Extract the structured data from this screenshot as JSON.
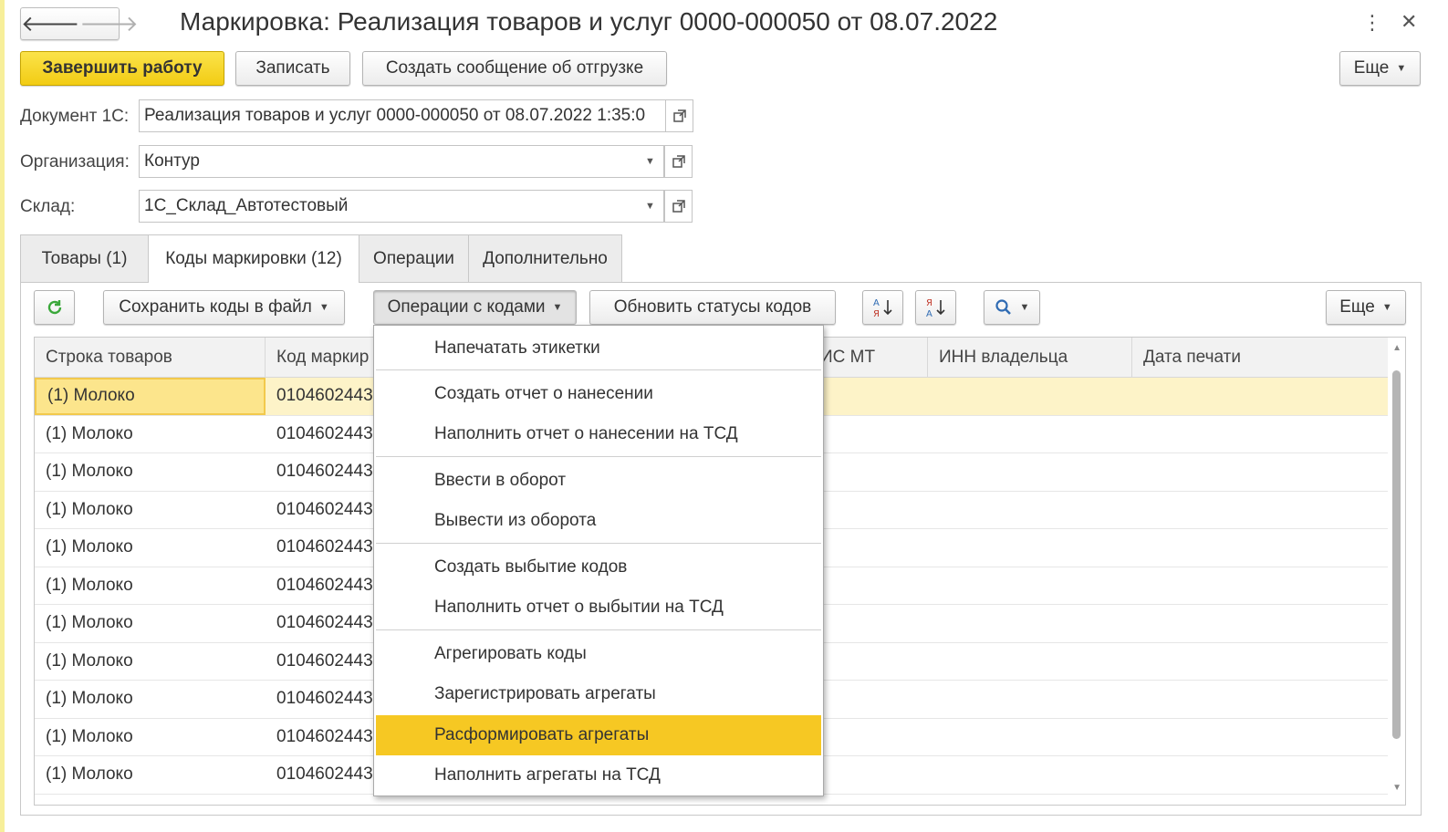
{
  "window": {
    "title": "Маркировка: Реализация товаров и услуг 0000-000050 от 08.07.2022"
  },
  "toolbar": {
    "finish_label": "Завершить работу",
    "save_label": "Записать",
    "create_msg_label": "Создать сообщение об отгрузке",
    "more_label": "Еще"
  },
  "form": {
    "doc_label": "Документ 1С:",
    "doc_value": "Реализация товаров и услуг 0000-000050 от 08.07.2022 1:35:0",
    "org_label": "Организация:",
    "org_value": "Контур",
    "warehouse_label": "Склад:",
    "warehouse_value": "1С_Склад_Автотестовый"
  },
  "tabs": [
    {
      "label": "Товары (1)",
      "active": false
    },
    {
      "label": "Коды маркировки (12)",
      "active": true
    },
    {
      "label": "Операции",
      "active": false
    },
    {
      "label": "Дополнительно",
      "active": false
    }
  ],
  "codes_toolbar": {
    "save_codes_label": "Сохранить коды в файл",
    "ops_label": "Операции с кодами",
    "refresh_statuses_label": "Обновить статусы кодов",
    "more_label": "Еще"
  },
  "grid": {
    "columns": [
      "Строка товаров",
      "Код маркир",
      "ИС МТ",
      "ИНН владельца",
      "Дата печати"
    ],
    "rows": [
      {
        "product": "(1) Молоко",
        "code": "0104602443"
      },
      {
        "product": "(1) Молоко",
        "code": "0104602443"
      },
      {
        "product": "(1) Молоко",
        "code": "0104602443"
      },
      {
        "product": "(1) Молоко",
        "code": "0104602443"
      },
      {
        "product": "(1) Молоко",
        "code": "0104602443"
      },
      {
        "product": "(1) Молоко",
        "code": "0104602443"
      },
      {
        "product": "(1) Молоко",
        "code": "0104602443"
      },
      {
        "product": "(1) Молоко",
        "code": "0104602443"
      },
      {
        "product": "(1) Молоко",
        "code": "0104602443"
      },
      {
        "product": "(1) Молоко",
        "code": "0104602443"
      },
      {
        "product": "(1) Молоко",
        "code": "0104602443"
      }
    ]
  },
  "menu": {
    "items": [
      "Напечатать этикетки",
      "Создать отчет о нанесении",
      "Наполнить отчет о нанесении на ТСД",
      "Ввести в оборот",
      "Вывести из оборота",
      "Создать выбытие кодов",
      "Наполнить отчет о выбытии на ТСД",
      "Агрегировать коды",
      "Зарегистрировать агрегаты",
      "Расформировать агрегаты",
      "Наполнить агрегаты на ТСД"
    ],
    "highlighted": "Расформировать агрегаты"
  },
  "colors": {
    "accent": "#f6c823",
    "primary_button": "#f2cc14",
    "selected_row": "#fdf3c8",
    "refresh_icon": "#3aa83a"
  },
  "icons": [
    "back-arrow-icon",
    "forward-arrow-icon",
    "more-vertical-icon",
    "close-icon",
    "open-link-icon",
    "dropdown-icon",
    "refresh-icon",
    "sort-ascending-icon",
    "sort-descending-icon",
    "search-icon"
  ]
}
